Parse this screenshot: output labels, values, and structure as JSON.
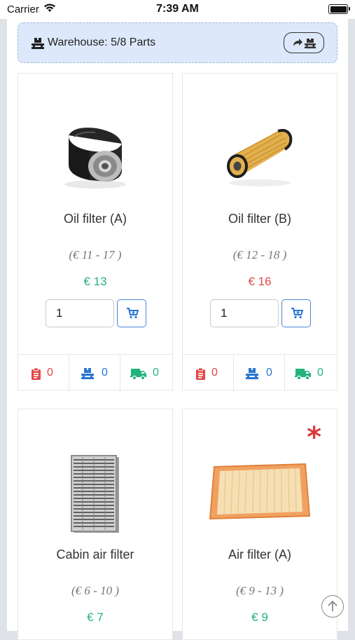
{
  "status_bar": {
    "carrier": "Carrier",
    "time": "7:39 AM"
  },
  "warehouse": {
    "label": "Warehouse: 5/8 Parts",
    "button_icon": "forward-warehouse-icon"
  },
  "products": [
    {
      "name": "Oil filter (A)",
      "range": "(€ 11 - 17 )",
      "price": "€ 13",
      "price_status": "green",
      "quantity": "1",
      "stats": {
        "orders": "0",
        "warehouse": "0",
        "delivery": "0"
      },
      "image": "oil-filter-black-image"
    },
    {
      "name": "Oil filter (B)",
      "range": "(€ 12 - 18 )",
      "price": "€ 16",
      "price_status": "red",
      "quantity": "1",
      "stats": {
        "orders": "0",
        "warehouse": "0",
        "delivery": "0"
      },
      "image": "oil-filter-cartridge-image"
    },
    {
      "name": "Cabin air filter",
      "range": "(€ 6 - 10 )",
      "price": "€ 7",
      "price_status": "green",
      "image": "cabin-air-filter-image"
    },
    {
      "name": "Air filter (A)",
      "range": "(€ 9 - 13 )",
      "price": "€ 9",
      "price_status": "green",
      "marker": "*",
      "image": "air-filter-panel-image"
    }
  ],
  "colors": {
    "green": "#23b27c",
    "red": "#e04848",
    "blue": "#2a76d2",
    "banner": "#dde9fb"
  }
}
